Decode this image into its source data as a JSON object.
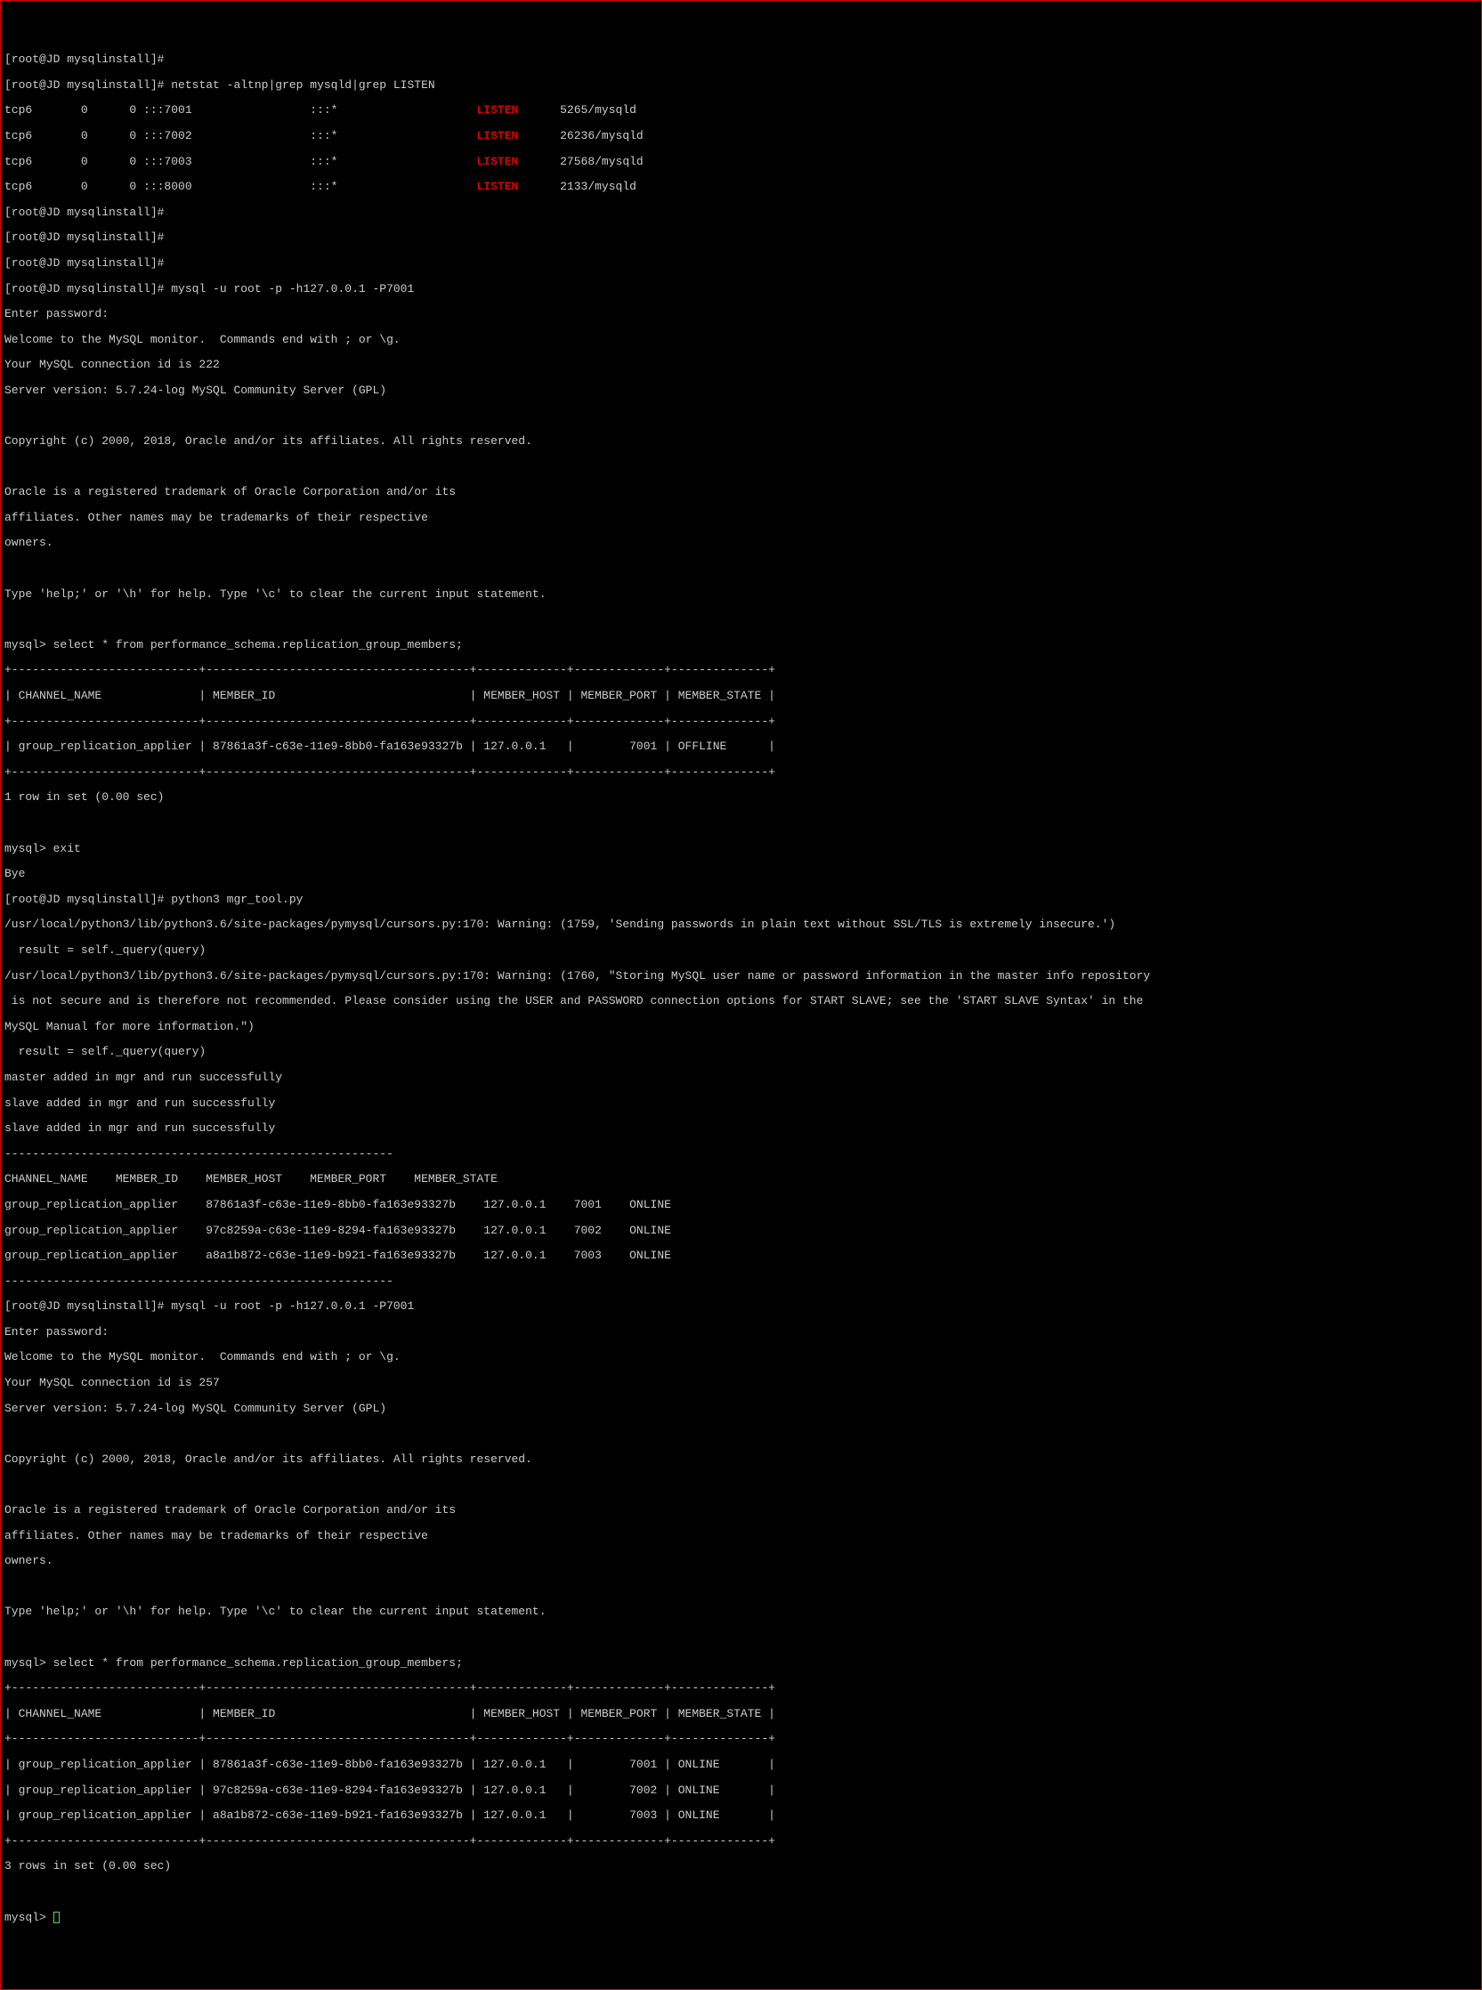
{
  "prompt": "[root@JD mysqlinstall]#",
  "mysql_prompt": "mysql>",
  "netstat_cmd": " netstat -altnp|grep mysqld|grep LISTEN",
  "netstat": [
    {
      "proto": "tcp6",
      "recv": "0",
      "send": "0",
      "local": ":::7001",
      "foreign": ":::*",
      "state": "LISTEN",
      "pid": "5265/mysqld"
    },
    {
      "proto": "tcp6",
      "recv": "0",
      "send": "0",
      "local": ":::7002",
      "foreign": ":::*",
      "state": "LISTEN",
      "pid": "26236/mysqld"
    },
    {
      "proto": "tcp6",
      "recv": "0",
      "send": "0",
      "local": ":::7003",
      "foreign": ":::*",
      "state": "LISTEN",
      "pid": "27568/mysqld"
    },
    {
      "proto": "tcp6",
      "recv": "0",
      "send": "0",
      "local": ":::8000",
      "foreign": ":::*",
      "state": "LISTEN",
      "pid": "2133/mysqld"
    }
  ],
  "mysql_login_cmd": " mysql -u root -p -h127.0.0.1 -P7001",
  "enter_password": "Enter password:",
  "welcome": "Welcome to the MySQL monitor.  Commands end with ; or \\g.",
  "conn_id_1": "Your MySQL connection id is 222",
  "conn_id_2": "Your MySQL connection id is 257",
  "server_version": "Server version: 5.7.24-log MySQL Community Server (GPL)",
  "copyright": "Copyright (c) 2000, 2018, Oracle and/or its affiliates. All rights reserved.",
  "trademark_1": "Oracle is a registered trademark of Oracle Corporation and/or its",
  "trademark_2": "affiliates. Other names may be trademarks of their respective",
  "trademark_3": "owners.",
  "help_line": "Type 'help;' or '\\h' for help. Type '\\c' to clear the current input statement.",
  "query": " select * from performance_schema.replication_group_members;",
  "tbl_border": "+---------------------------+--------------------------------------+-------------+-------------+--------------+",
  "tbl_header": "| CHANNEL_NAME              | MEMBER_ID                            | MEMBER_HOST | MEMBER_PORT | MEMBER_STATE |",
  "tbl_row_offline": "| group_replication_applier | 87861a3f-c63e-11e9-8bb0-fa163e93327b | 127.0.0.1   |        7001 | OFFLINE      |",
  "rows_1": "1 row in set (0.00 sec)",
  "exit_cmd": " exit",
  "bye": "Bye",
  "python_cmd": " python3 mgr_tool.py",
  "warn_1": "/usr/local/python3/lib/python3.6/site-packages/pymysql/cursors.py:170: Warning: (1759, 'Sending passwords in plain text without SSL/TLS is extremely insecure.')",
  "result_line": "  result = self._query(query)",
  "warn_2a": "/usr/local/python3/lib/python3.6/site-packages/pymysql/cursors.py:170: Warning: (1760, \"Storing MySQL user name or password information in the master info repository",
  "warn_2b": " is not secure and is therefore not recommended. Please consider using the USER and PASSWORD connection options for START SLAVE; see the 'START SLAVE Syntax' in the",
  "warn_2c": "MySQL Manual for more information.\")",
  "master_added": "master added in mgr and run successfully",
  "slave_added": "slave added in mgr and run successfully",
  "dash_line": "--------------------------------------------------------",
  "py_header": "CHANNEL_NAME    MEMBER_ID    MEMBER_HOST    MEMBER_PORT    MEMBER_STATE",
  "py_row_1": "group_replication_applier    87861a3f-c63e-11e9-8bb0-fa163e93327b    127.0.0.1    7001    ONLINE",
  "py_row_2": "group_replication_applier    97c8259a-c63e-11e9-8294-fa163e93327b    127.0.0.1    7002    ONLINE",
  "py_row_3": "group_replication_applier    a8a1b872-c63e-11e9-b921-fa163e93327b    127.0.0.1    7003    ONLINE",
  "tbl2_row_1": "| group_replication_applier | 87861a3f-c63e-11e9-8bb0-fa163e93327b | 127.0.0.1   |        7001 | ONLINE       |",
  "tbl2_row_2": "| group_replication_applier | 97c8259a-c63e-11e9-8294-fa163e93327b | 127.0.0.1   |        7002 | ONLINE       |",
  "tbl2_row_3": "| group_replication_applier | a8a1b872-c63e-11e9-b921-fa163e93327b | 127.0.0.1   |        7003 | ONLINE       |",
  "rows_3": "3 rows in set (0.00 sec)"
}
